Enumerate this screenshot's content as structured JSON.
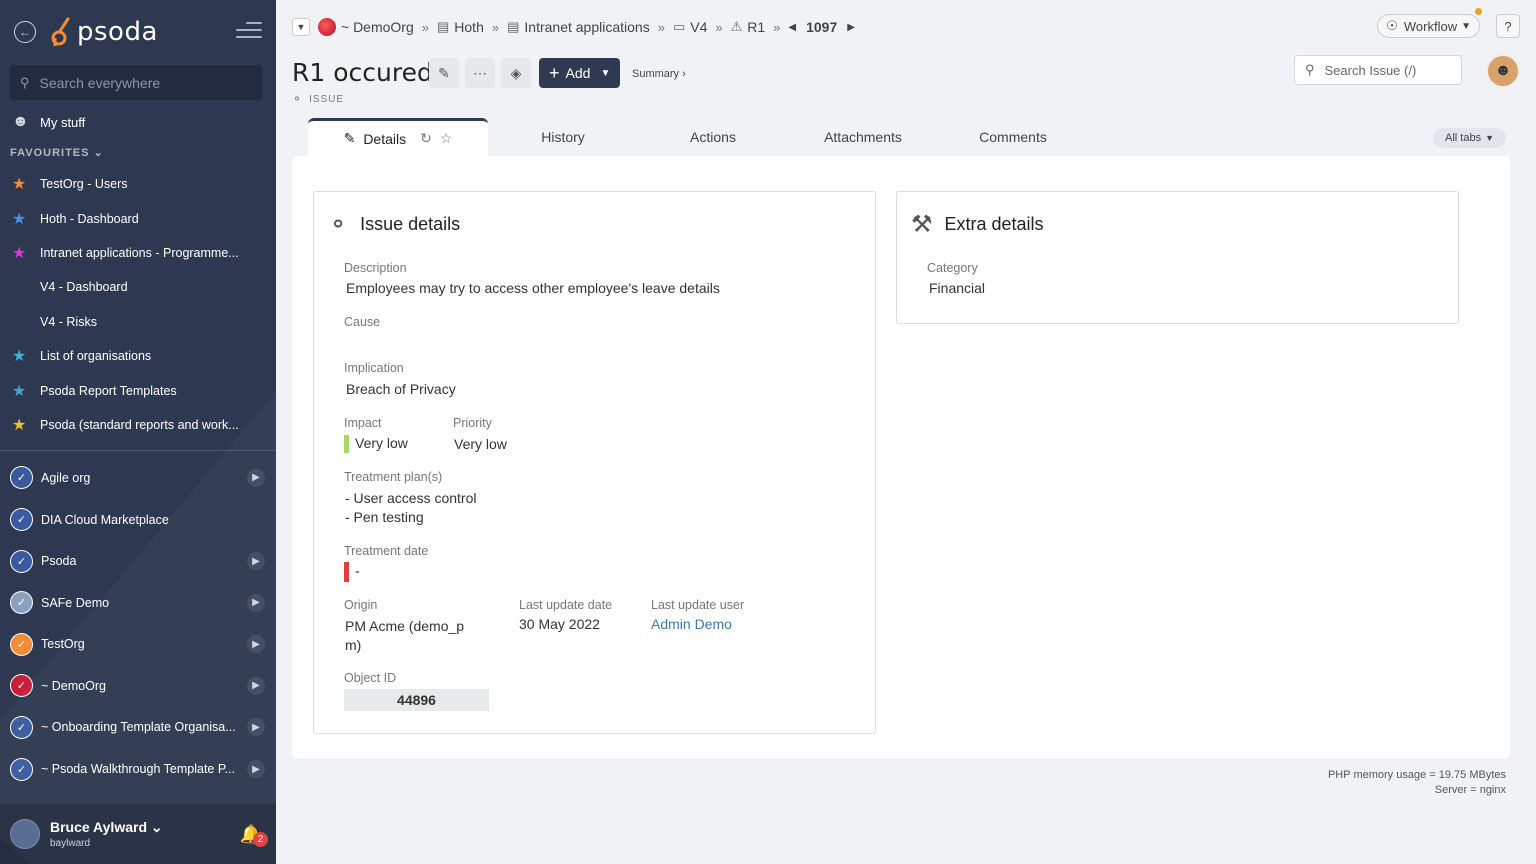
{
  "sidebar": {
    "brand": "psoda",
    "search_placeholder": "Search everywhere",
    "my_stuff": "My stuff",
    "favourites_header": "FAVOURITES",
    "favourites": [
      {
        "label": "TestOrg - Users",
        "color": "#f28c38"
      },
      {
        "label": "Hoth - Dashboard",
        "color": "#4a90e2"
      },
      {
        "label": "Intranet applications - Programme...",
        "color": "#d63ad6"
      },
      {
        "label": "V4 - Dashboard",
        "color": "#333a48"
      },
      {
        "label": "V4 - Risks",
        "color": "#333a48"
      },
      {
        "label": "List of organisations",
        "color": "#3ab4d6"
      },
      {
        "label": "Psoda Report Templates",
        "color": "#4aa0d6"
      },
      {
        "label": "Psoda (standard reports and work...",
        "color": "#e8c030"
      }
    ],
    "orgs": [
      {
        "label": "Agile org",
        "chevron": true
      },
      {
        "label": "DIA Cloud Marketplace",
        "chevron": false
      },
      {
        "label": "Psoda",
        "chevron": true
      },
      {
        "label": "SAFe Demo",
        "chevron": true
      },
      {
        "label": "TestOrg",
        "chevron": true
      },
      {
        "label": "~ DemoOrg",
        "chevron": true
      },
      {
        "label": "~ Onboarding Template Organisa...",
        "chevron": true
      },
      {
        "label": "~ Psoda Walkthrough Template P...",
        "chevron": true
      }
    ],
    "user": {
      "name": "Bruce Aylward",
      "login": "baylward",
      "notifications": "2"
    }
  },
  "breadcrumb": {
    "org": "~ DemoOrg",
    "items": [
      "Hoth",
      "Intranet applications",
      "V4",
      "R1"
    ],
    "number": "1097"
  },
  "header": {
    "workflow_label": "Workflow",
    "help_label": "?",
    "title": "R1 occured",
    "add_label": "Add",
    "summary_link": "Summary ›",
    "object_type": "ISSUE",
    "search_placeholder": "Search Issue (/)"
  },
  "tabs": [
    "Details",
    "History",
    "Actions",
    "Attachments",
    "Comments"
  ],
  "all_tabs_label": "All tabs",
  "issue_details": {
    "title": "Issue details",
    "description_label": "Description",
    "description": "Employees may try to access other employee's leave details",
    "cause_label": "Cause",
    "implication_label": "Implication",
    "implication": "Breach of Privacy",
    "impact_label": "Impact",
    "impact": "Very low",
    "priority_label": "Priority",
    "priority": "Very low",
    "treatment_plans_label": "Treatment plan(s)",
    "treatment_plan_1": "- User access control",
    "treatment_plan_2": "- Pen testing",
    "treatment_date_label": "Treatment date",
    "treatment_date": "-",
    "origin_label": "Origin",
    "origin_line1": "PM Acme (demo_p",
    "origin_line2": "m)",
    "last_update_date_label": "Last update date",
    "last_update_date": "30 May 2022",
    "last_update_user_label": "Last update user",
    "last_update_user": "Admin Demo",
    "object_id_label": "Object ID",
    "object_id": "44896"
  },
  "extra_details": {
    "title": "Extra details",
    "category_label": "Category",
    "category": "Financial"
  },
  "footer": {
    "memory": "PHP memory usage = 19.75 MBytes",
    "server": "Server = nginx"
  },
  "colors": {
    "sidebar_bg": "#2e3850",
    "impact_bar": "#a8d86a",
    "treatment_date_bar": "#e03d3d",
    "link": "#3a78b5"
  }
}
